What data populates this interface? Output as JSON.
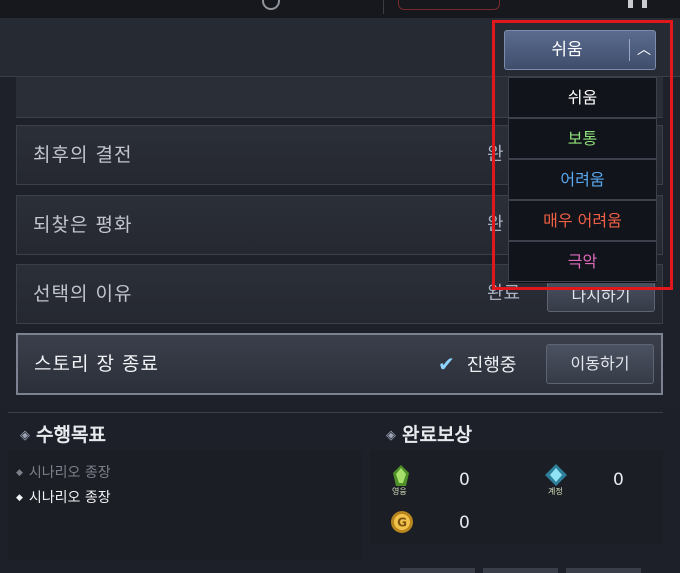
{
  "dropdown": {
    "selected": "쉬움",
    "options": [
      {
        "label": "쉬움",
        "color": "#ffffff"
      },
      {
        "label": "보통",
        "color": "#8ee07a"
      },
      {
        "label": "어려움",
        "color": "#5aaaf2"
      },
      {
        "label": "매우 어려움",
        "color": "#f26045"
      },
      {
        "label": "극악",
        "color": "#e06bbd"
      }
    ]
  },
  "chapters": [
    {
      "title": "최후의 결전",
      "status": "완",
      "button": ""
    },
    {
      "title": "되찾은 평화",
      "status": "완",
      "button": ""
    },
    {
      "title": "선택의 이유",
      "status": "완료",
      "button": "다시하기"
    },
    {
      "title": "스토리 장 종료",
      "status": "진행중",
      "button": "이동하기"
    }
  ],
  "objectives": {
    "title": "수행목표",
    "items": [
      {
        "label": "시나리오 종장",
        "done": true
      },
      {
        "label": "시나리오 종장",
        "done": false
      }
    ]
  },
  "rewards": {
    "title": "완료보상",
    "items": [
      {
        "icon": "hero-icon",
        "caption": "영웅",
        "value": "0"
      },
      {
        "icon": "crystal-icon",
        "caption": "계정",
        "value": "0"
      },
      {
        "icon": "gold-icon",
        "caption": "",
        "value": "0"
      }
    ]
  },
  "colors": {
    "highlight": "#e0181c",
    "accent": "#8fd3ff"
  }
}
